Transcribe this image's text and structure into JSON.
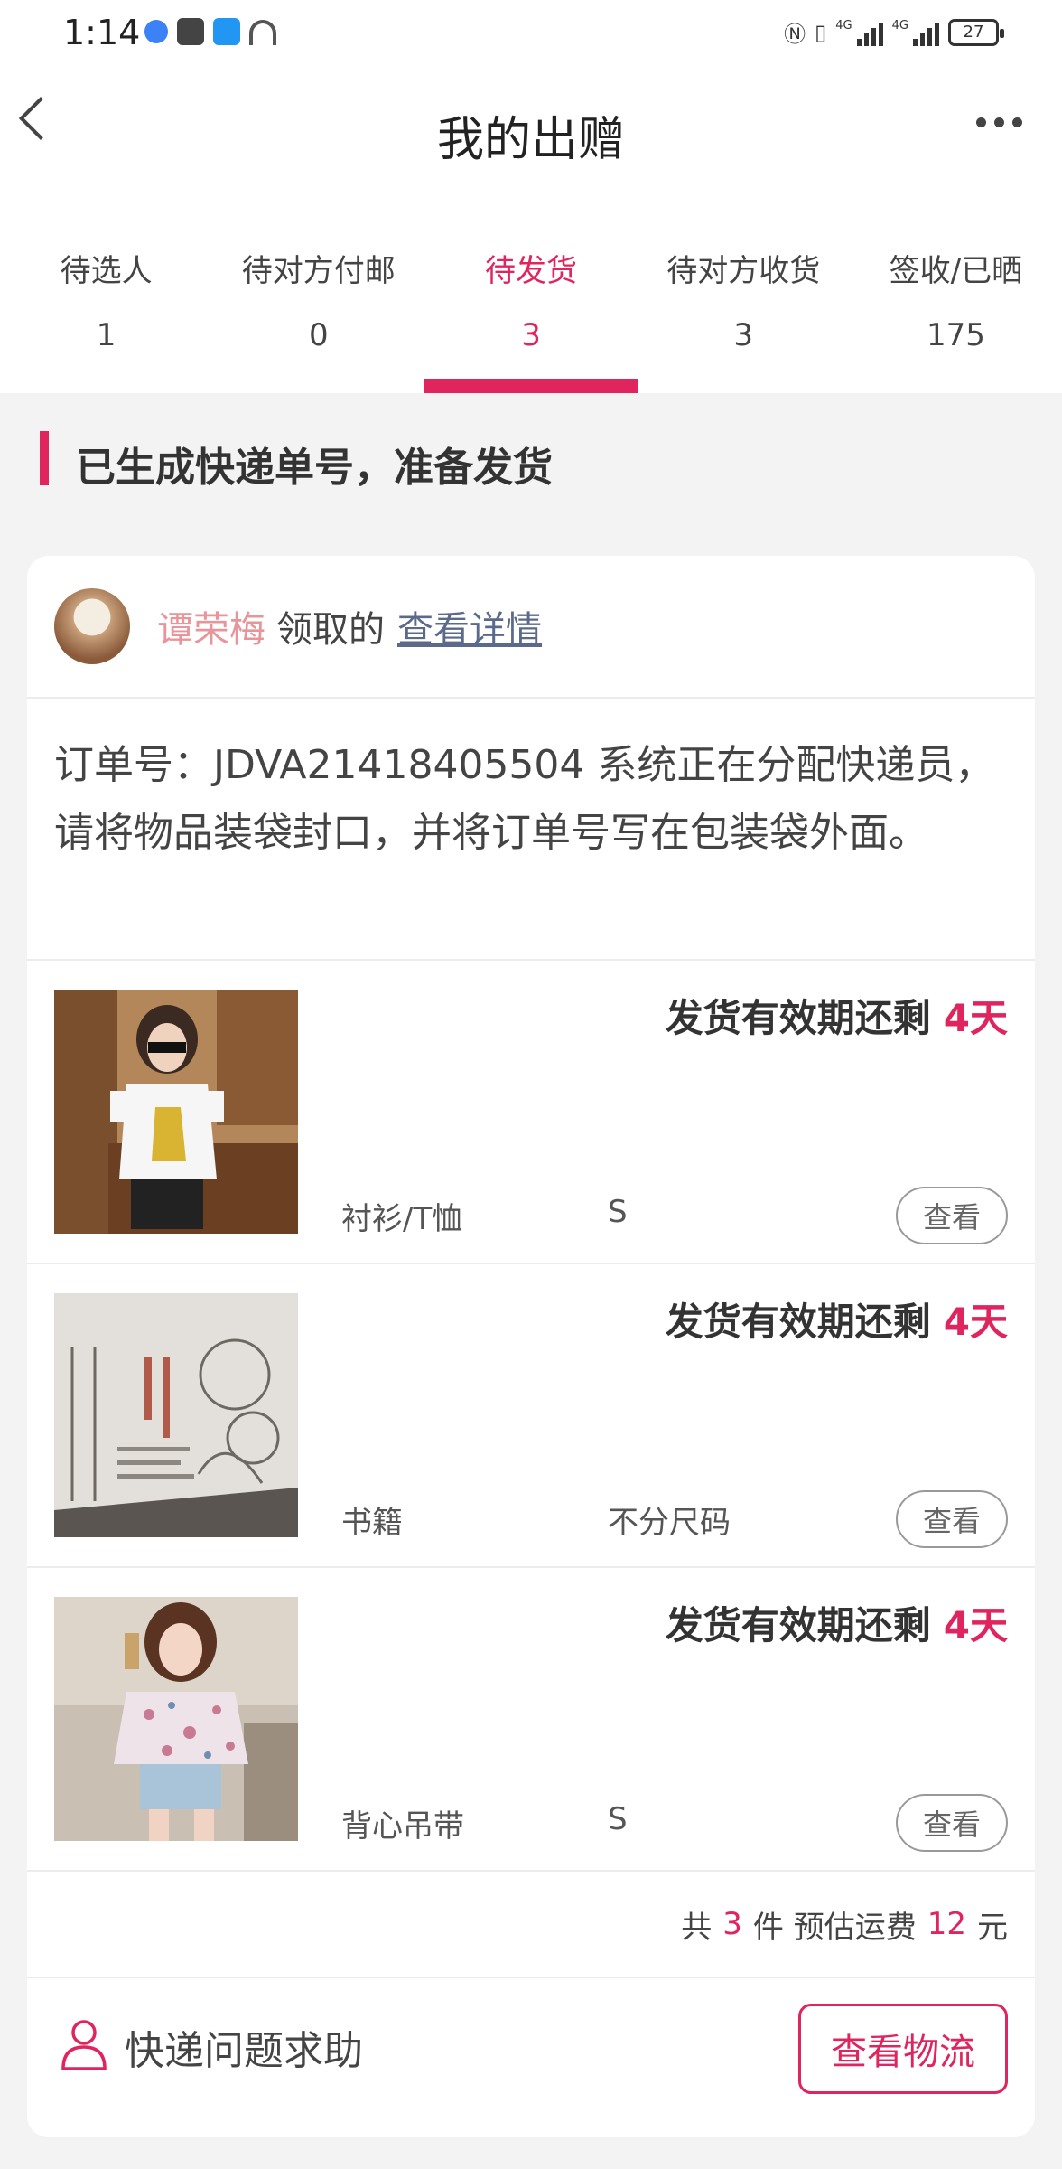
{
  "status_bar": {
    "time": "1:14",
    "battery": "27",
    "network_1": "4G",
    "network_2": "4G"
  },
  "header": {
    "title": "我的出赠"
  },
  "tabs": [
    {
      "label": "待选人",
      "count": "1"
    },
    {
      "label": "待对方付邮",
      "count": "0"
    },
    {
      "label": "待发货",
      "count": "3",
      "active": true
    },
    {
      "label": "待对方收货",
      "count": "3"
    },
    {
      "label": "签收/已晒",
      "count": "175"
    }
  ],
  "section": {
    "title": "已生成快递单号，准备发货"
  },
  "card": {
    "claimer_name": "谭荣梅",
    "claimer_suffix": "领取的",
    "details_link": "查看详情",
    "order_note": "订单号：JDVA21418405504 系统正在分配快递员，请将物品装袋封口，并将订单号写在包装袋外面。",
    "items": [
      {
        "deadline_label": "发货有效期还剩",
        "days": "4天",
        "category": "衬衫/T恤",
        "size": "S",
        "view": "查看"
      },
      {
        "deadline_label": "发货有效期还剩",
        "days": "4天",
        "category": "书籍",
        "size": "不分尺码",
        "view": "查看"
      },
      {
        "deadline_label": "发货有效期还剩",
        "days": "4天",
        "category": "背心吊带",
        "size": "S",
        "view": "查看"
      }
    ],
    "summary": {
      "prefix": "共",
      "count": "3",
      "middle": "件 预估运费",
      "fee": "12",
      "suffix": "元"
    },
    "footer": {
      "help_text": "快递问题求助",
      "logistics_button": "查看物流"
    }
  },
  "colors": {
    "accent": "#e0245e",
    "claimer_name": "#e7959a",
    "link": "#5b6a8a"
  }
}
